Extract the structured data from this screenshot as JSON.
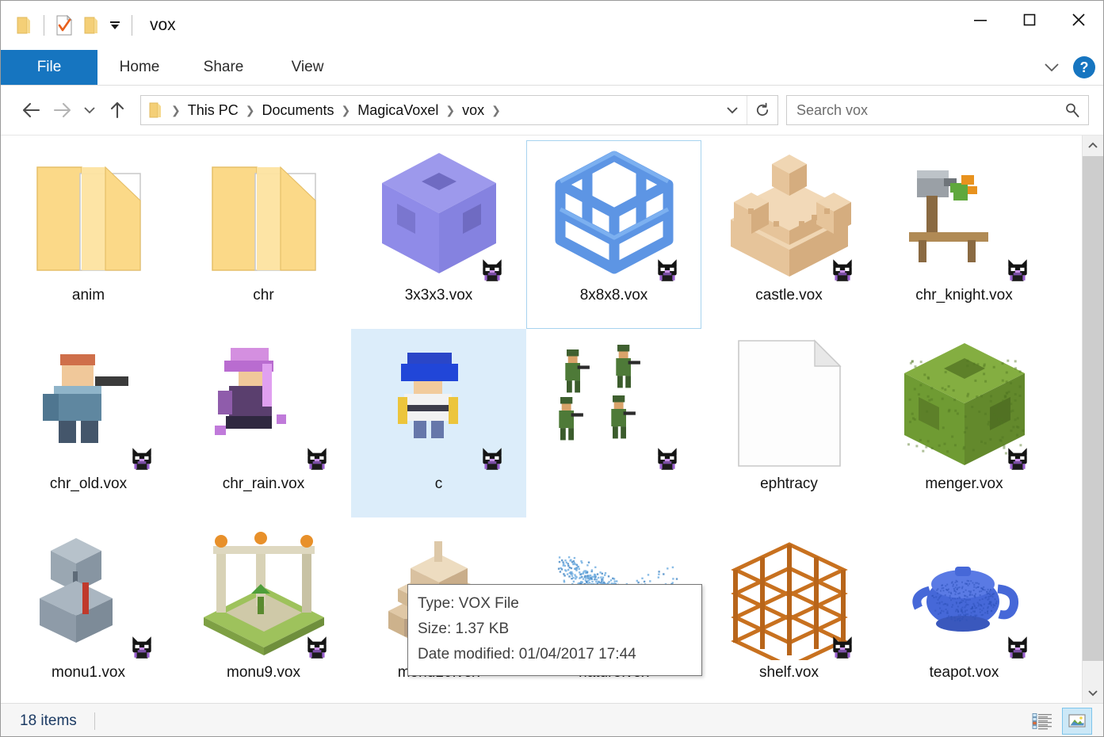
{
  "window": {
    "title": "vox",
    "minimize_label": "Minimize",
    "maximize_label": "Maximize",
    "close_label": "Close"
  },
  "quick_access": {
    "folder_label": "Folder",
    "properties_label": "Properties",
    "new_folder_label": "New folder",
    "customize_label": "Customize Quick Access Toolbar"
  },
  "ribbon": {
    "tabs": [
      {
        "label": "File",
        "active": true
      },
      {
        "label": "Home",
        "active": false
      },
      {
        "label": "Share",
        "active": false
      },
      {
        "label": "View",
        "active": false
      }
    ],
    "expand_label": "Expand the Ribbon",
    "help_label": "?"
  },
  "address": {
    "back_label": "Back",
    "forward_label": "Forward",
    "recent_label": "Recent locations",
    "up_label": "Up",
    "breadcrumbs": [
      "This PC",
      "Documents",
      "MagicaVoxel",
      "vox"
    ],
    "dropdown_label": "Previous locations",
    "refresh_label": "Refresh"
  },
  "search": {
    "placeholder": "Search vox",
    "value": ""
  },
  "files": {
    "rows": [
      [
        {
          "name": "anim",
          "kind": "folder",
          "state": "normal"
        },
        {
          "name": "chr",
          "kind": "folder",
          "state": "normal"
        },
        {
          "name": "3x3x3.vox",
          "kind": "vox",
          "state": "normal"
        },
        {
          "name": "8x8x8.vox",
          "kind": "vox",
          "state": "selected"
        },
        {
          "name": "castle.vox",
          "kind": "vox",
          "state": "normal"
        },
        {
          "name": "chr_knight.vox",
          "kind": "vox",
          "state": "normal"
        }
      ],
      [
        {
          "name": "chr_old.vox",
          "kind": "vox",
          "state": "normal"
        },
        {
          "name": "chr_rain.vox",
          "kind": "vox",
          "state": "normal"
        },
        {
          "name": "c",
          "kind": "vox",
          "state": "hover"
        },
        {
          "name": "",
          "kind": "vox",
          "state": "normal"
        },
        {
          "name": "ephtracy",
          "kind": "blank",
          "state": "normal"
        },
        {
          "name": "menger.vox",
          "kind": "vox",
          "state": "normal"
        }
      ],
      [
        {
          "name": "monu1.vox",
          "kind": "vox",
          "state": "normal"
        },
        {
          "name": "monu9.vox",
          "kind": "vox",
          "state": "normal"
        },
        {
          "name": "monu10.vox",
          "kind": "vox",
          "state": "normal"
        },
        {
          "name": "nature.vox",
          "kind": "vox",
          "state": "normal"
        },
        {
          "name": "shelf.vox",
          "kind": "vox",
          "state": "normal"
        },
        {
          "name": "teapot.vox",
          "kind": "vox",
          "state": "normal"
        }
      ]
    ]
  },
  "tooltip": {
    "type": "Type: VOX File",
    "size": "Size: 1.37 KB",
    "date": "Date modified: 01/04/2017 17:44"
  },
  "status": {
    "items_text": "18 items",
    "details_view_label": "Details view",
    "large_icons_view_label": "Large icons view"
  },
  "colors": {
    "accent": "#1675c0",
    "selection_border": "#a7d3ef",
    "hover_background": "#dcedfa",
    "folder": "#fcd77f",
    "purple_cube": "#8f8be8",
    "blue_cube": "#4f8fe0",
    "castle_tan": "#e8c79b",
    "menger_green": "#6f9b33",
    "shelf_orange": "#c8711f",
    "nature_blue": "#68a8dd",
    "teapot_blue": "#3f63d4"
  }
}
